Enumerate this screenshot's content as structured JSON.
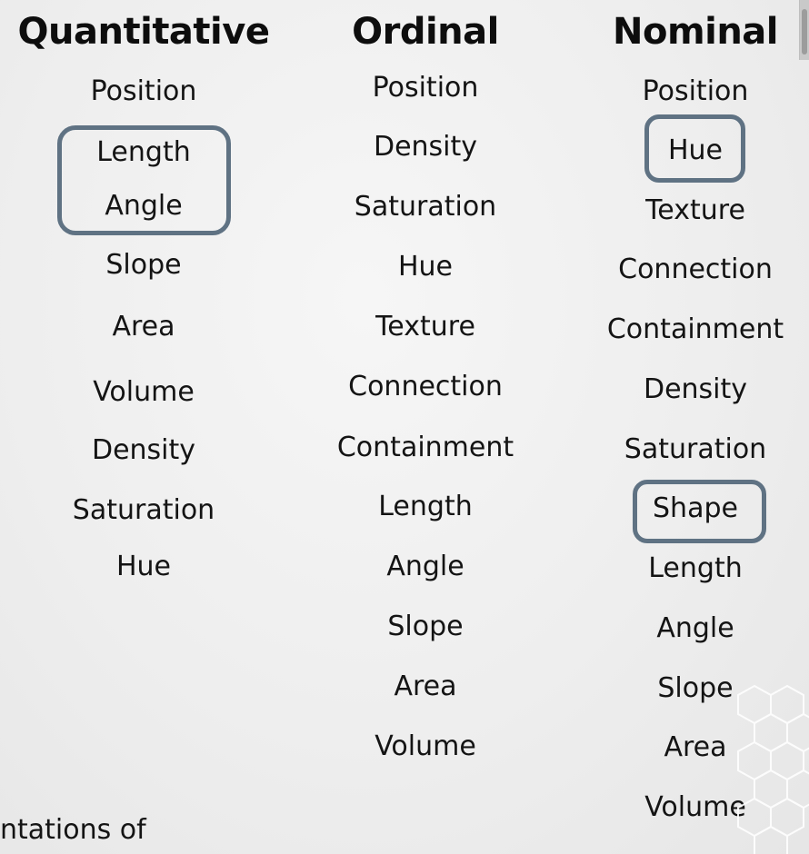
{
  "columns": [
    {
      "title": "Quantitative",
      "items": [
        "Position",
        "Length",
        "Angle",
        "Slope",
        "Area",
        "Volume",
        "Density",
        "Saturation",
        "Hue"
      ]
    },
    {
      "title": "Ordinal",
      "items": [
        "Position",
        "Density",
        "Saturation",
        "Hue",
        "Texture",
        "Connection",
        "Containment",
        "Length",
        "Angle",
        "Slope",
        "Area",
        "Volume"
      ]
    },
    {
      "title": "Nominal",
      "items": [
        "Position",
        "Hue",
        "Texture",
        "Connection",
        "Containment",
        "Density",
        "Saturation",
        "Shape",
        "Length",
        "Angle",
        "Slope",
        "Area",
        "Volume"
      ]
    }
  ],
  "footer_fragment": "ntations of",
  "colors": {
    "highlight_border": "#5f7283",
    "background": "#eeeeee",
    "text": "#141414"
  },
  "icons": [
    "hexagon-pattern-icon"
  ]
}
